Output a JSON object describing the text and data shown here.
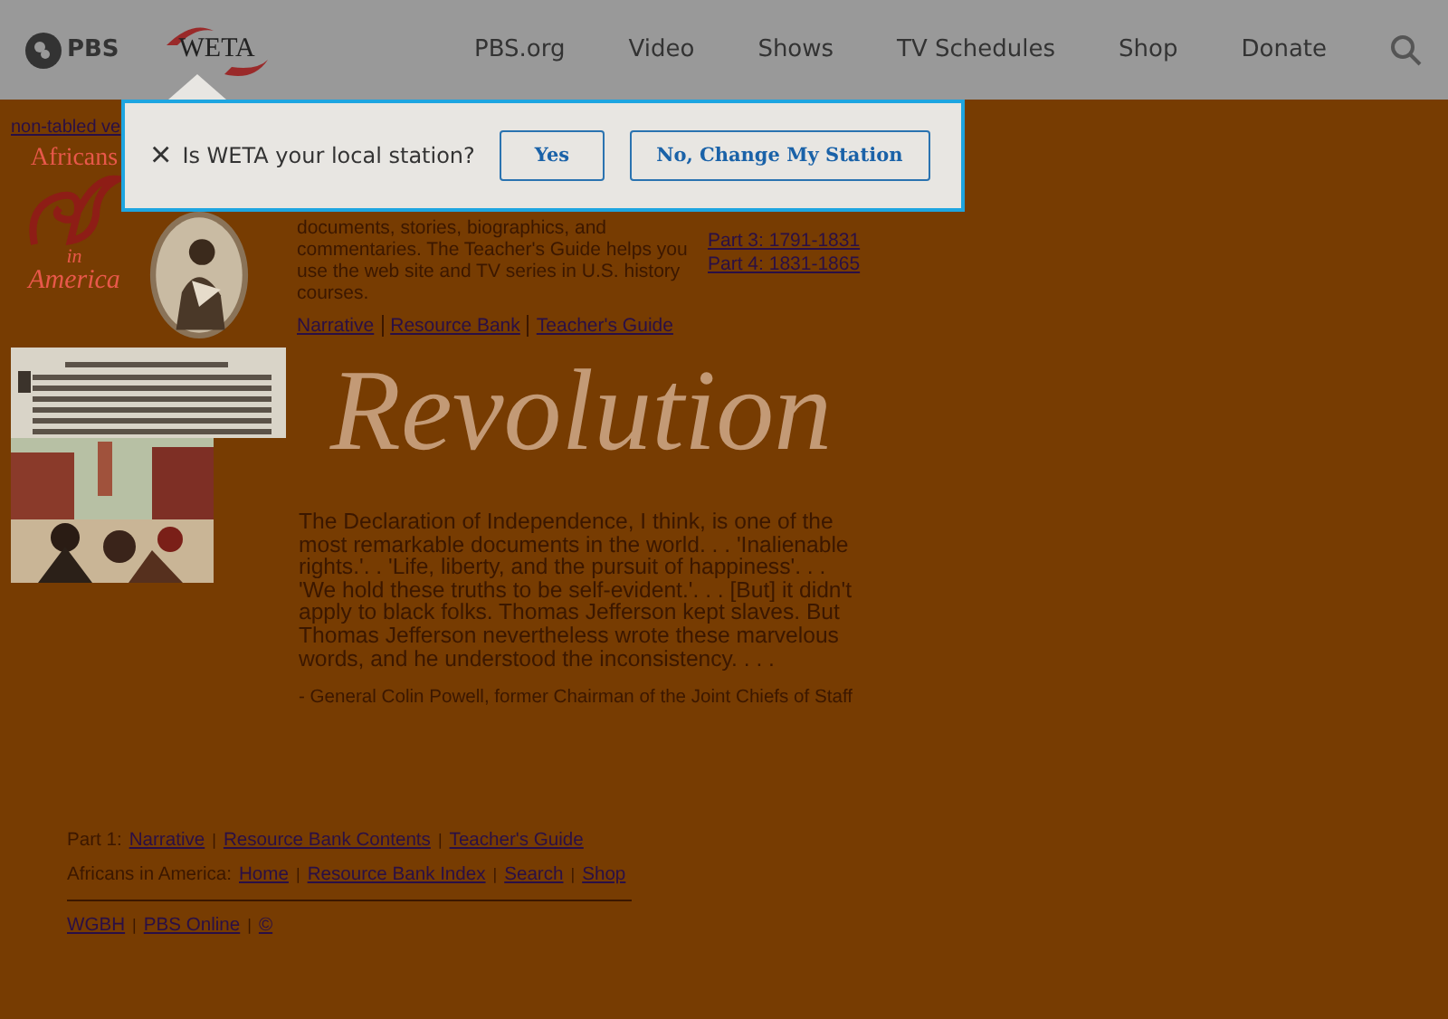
{
  "header": {
    "pbs_logo": "PBS",
    "station_logo": "WETA",
    "nav": [
      "PBS.org",
      "Video",
      "Shows",
      "TV Schedules",
      "Shop",
      "Donate"
    ]
  },
  "station_prompt": {
    "close": "×",
    "question": "Is WETA your local station?",
    "buttons": [
      "Yes",
      "No, Change My Station"
    ]
  },
  "page": {
    "top_link": "non-tabled ve",
    "logo": {
      "line_1": "Africans",
      "line_2": "in",
      "line_3": "America"
    },
    "intro": [
      "documents, stories, biographics, and",
      "commentaries. The Teacher's Guide helps you",
      "use the web site and TV series in U.S. history",
      "courses."
    ],
    "intro_links": [
      "Narrative",
      "Resource Bank",
      "Teacher's Guide"
    ],
    "parts": [
      "Part 3: 1791-1831",
      "Part 4: 1831-1865"
    ],
    "title": "Revolution",
    "quote": "The Declaration of Independence, I think, is one of the most remarkable documents in the world. . . 'Inalienable rights.'. . 'Life, liberty, and the pursuit of happiness'. . . 'We hold these truths to be self-evident.'. . . [But] it didn't apply to black folks. Thomas Jefferson kept slaves. But Thomas Jefferson nevertheless wrote these marvelous words, and he understood the inconsistency. . . .",
    "attribution": "- General Colin Powell, former Chairman of the Joint Chiefs of Staff",
    "footer": [
      {
        "label": "Part 1:",
        "separator": "|",
        "links": [
          "Narrative",
          "Resource Bank Contents",
          "Teacher's Guide"
        ]
      },
      {
        "label": "Africans in America:",
        "separator": "|",
        "links": [
          "Home",
          "Resource Bank Index",
          "Search",
          "Shop"
        ]
      }
    ],
    "bottom_separator": "|",
    "bottom_links": [
      "WGBH",
      "PBS Online",
      "©"
    ]
  }
}
